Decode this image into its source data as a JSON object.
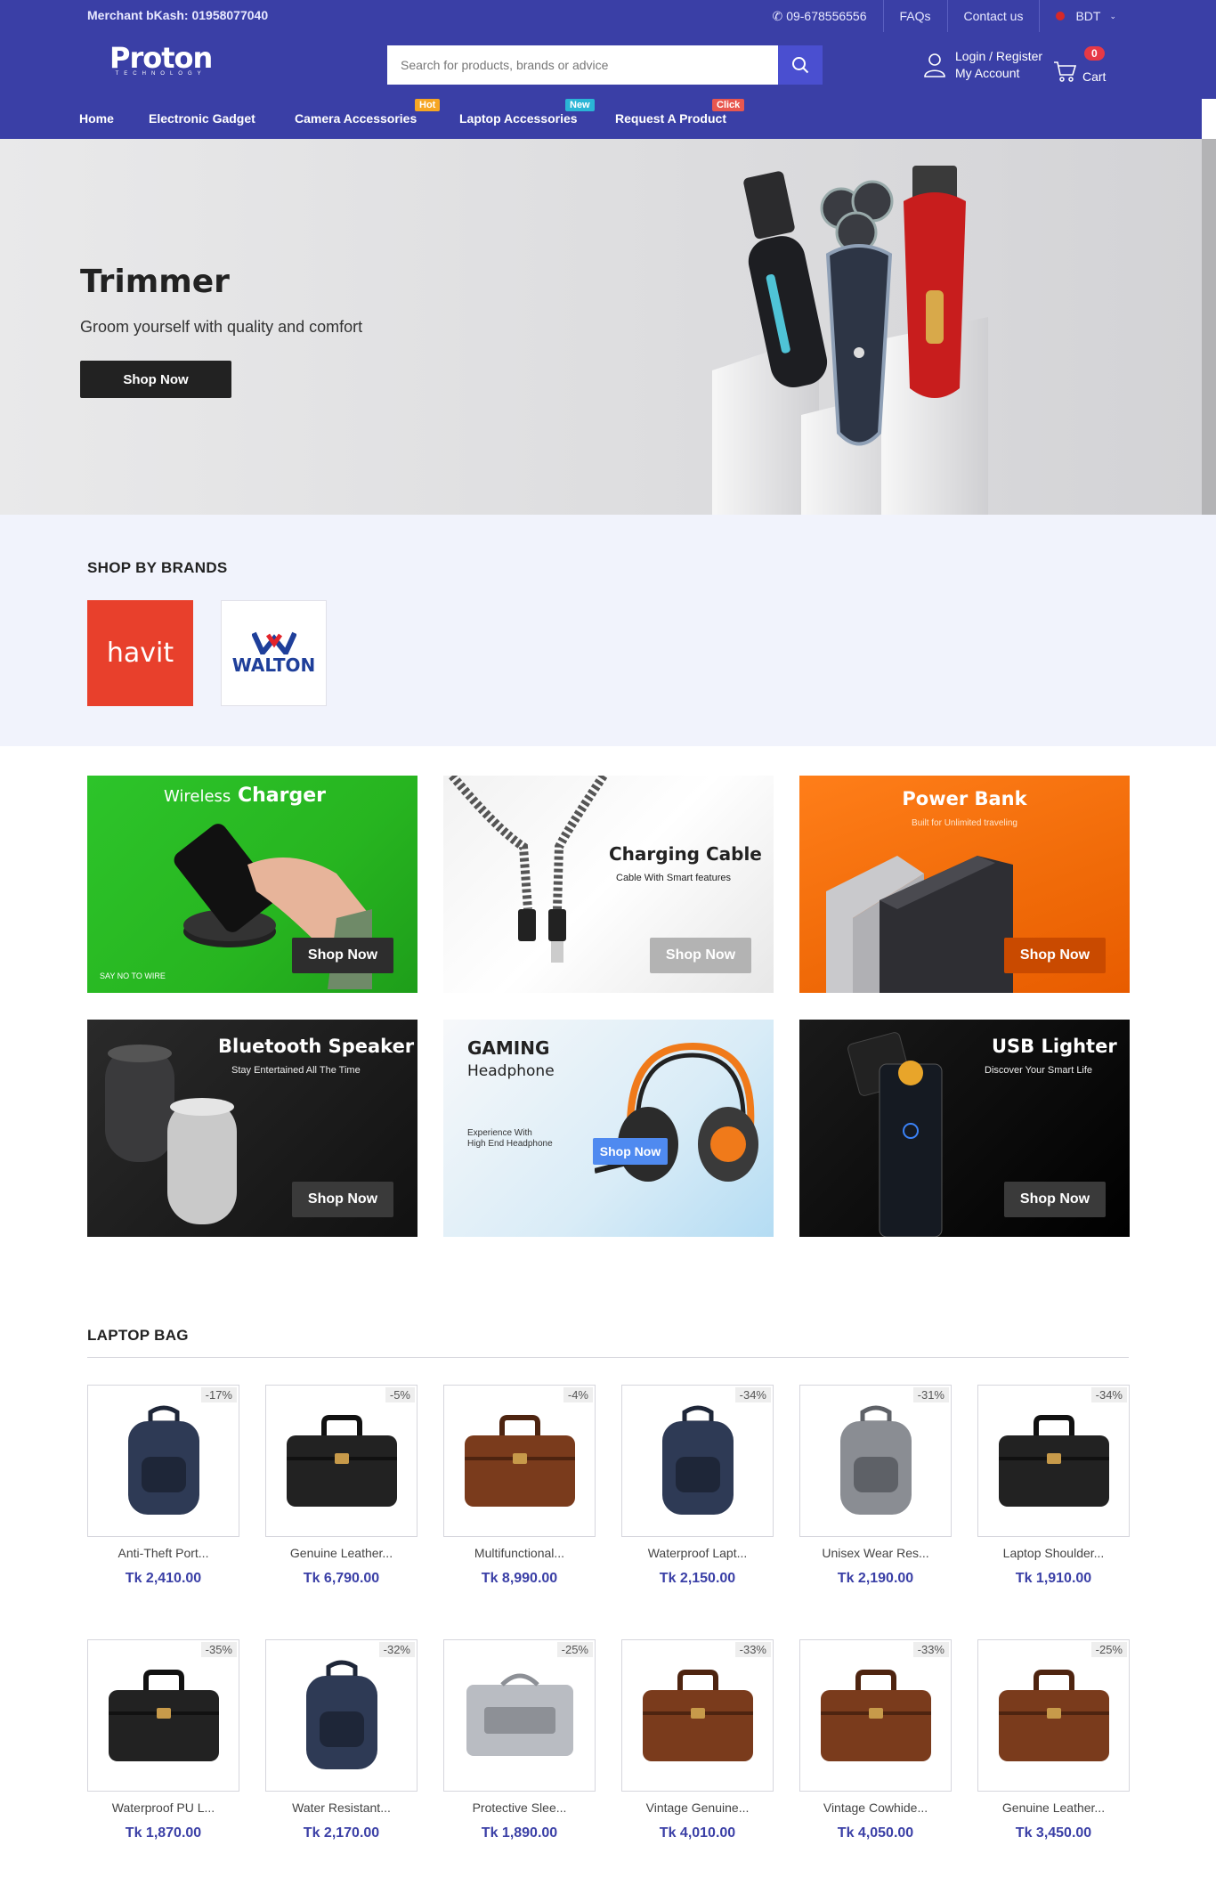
{
  "topbar": {
    "merchant": "Merchant bKash: 01958077040",
    "phone": "09-678556556",
    "faqs": "FAQs",
    "contact": "Contact us",
    "currency": "BDT"
  },
  "header": {
    "logo_text": "Proton",
    "logo_sub": "TECHNOLOGY",
    "search_placeholder": "Search for products, brands or advice",
    "login_label": "Login / Register",
    "account_label": "My Account",
    "cart_count": "0",
    "cart_label": "Cart"
  },
  "nav": {
    "items": [
      {
        "label": "Home"
      },
      {
        "label": "Electronic Gadget"
      },
      {
        "label": "Camera Accessories",
        "tag": "Hot"
      },
      {
        "label": "Laptop Accessories",
        "tag": "New"
      },
      {
        "label": "Request A Product",
        "tag": "Click"
      }
    ]
  },
  "hero": {
    "title": "Trimmer",
    "subtitle": "Groom yourself with quality and comfort",
    "button": "Shop Now"
  },
  "brands": {
    "title": "SHOP BY BRANDS",
    "items": [
      {
        "name": "havit"
      },
      {
        "name": "WALTON"
      }
    ]
  },
  "banners": [
    {
      "title_light": "Wireless",
      "title_bold": "Charger",
      "note": "SAY NO TO WIRE",
      "button": "Shop Now"
    },
    {
      "title": "Charging Cable",
      "subtitle": "Cable With Smart features",
      "button": "Shop Now"
    },
    {
      "title": "Power Bank",
      "subtitle": "Built for Unlimited traveling",
      "button": "Shop Now"
    },
    {
      "title": "Bluetooth Speaker",
      "subtitle": "Stay Entertained All The Time",
      "button": "Shop Now"
    },
    {
      "title": "GAMING",
      "title2": "Headphone",
      "subtitle": "Experience With",
      "subtitle2": "High End Headphone",
      "button": "Shop Now"
    },
    {
      "title": "USB Lighter",
      "subtitle": "Discover Your Smart Life",
      "button": "Shop Now"
    }
  ],
  "laptop_bag": {
    "title": "LAPTOP BAG",
    "products": [
      {
        "discount": "-17%",
        "name": "Anti-Theft Port...",
        "price": "Tk 2,410.00",
        "icon": "backpack-icon"
      },
      {
        "discount": "-5%",
        "name": "Genuine Leather...",
        "price": "Tk 6,790.00",
        "icon": "briefcase-icon"
      },
      {
        "discount": "-4%",
        "name": "Multifunctional...",
        "price": "Tk 8,990.00",
        "icon": "briefcase-icon"
      },
      {
        "discount": "-34%",
        "name": "Waterproof Lapt...",
        "price": "Tk 2,150.00",
        "icon": "backpack-icon"
      },
      {
        "discount": "-31%",
        "name": "Unisex Wear Res...",
        "price": "Tk 2,190.00",
        "icon": "backpack-icon"
      },
      {
        "discount": "-34%",
        "name": "Laptop Shoulder...",
        "price": "Tk 1,910.00",
        "icon": "briefcase-icon"
      },
      {
        "discount": "-35%",
        "name": "Waterproof PU L...",
        "price": "Tk 1,870.00",
        "icon": "briefcase-icon"
      },
      {
        "discount": "-32%",
        "name": "Water Resistant...",
        "price": "Tk 2,170.00",
        "icon": "backpack-icon"
      },
      {
        "discount": "-25%",
        "name": "Protective Slee...",
        "price": "Tk 1,890.00",
        "icon": "sleeve-icon"
      },
      {
        "discount": "-33%",
        "name": "Vintage Genuine...",
        "price": "Tk 4,010.00",
        "icon": "briefcase-icon"
      },
      {
        "discount": "-33%",
        "name": "Vintage Cowhide...",
        "price": "Tk 4,050.00",
        "icon": "briefcase-icon"
      },
      {
        "discount": "-25%",
        "name": "Genuine Leather...",
        "price": "Tk 3,450.00",
        "icon": "briefcase-icon"
      }
    ]
  },
  "colors": {
    "brand": "#3a3fa6",
    "accent": "#4a4fd0",
    "badge": "#e63946",
    "havit": "#e8402c"
  }
}
